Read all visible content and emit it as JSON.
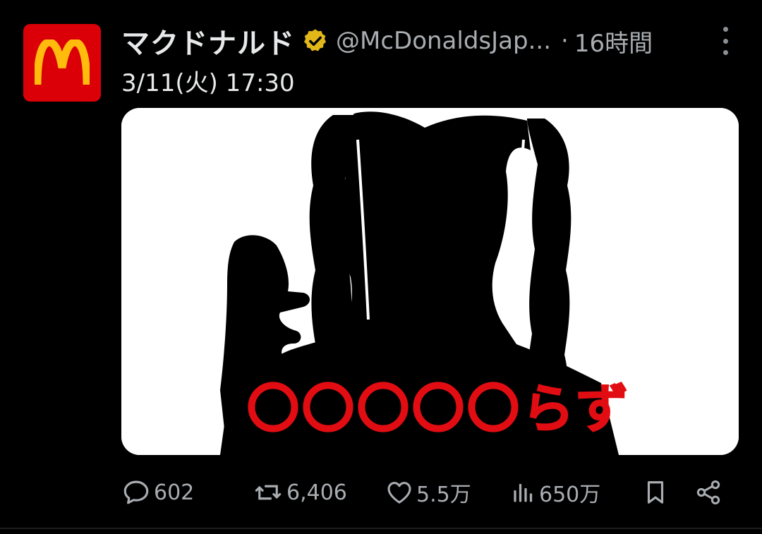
{
  "post": {
    "author_name": "マクドナルド",
    "handle": "@McDonaldsJap...",
    "separator": "·",
    "time": "16時間",
    "text": "3/11(火) 17:30",
    "media_overlay_text": "〇〇〇〇〇らず",
    "verified_color": "#e2b719",
    "avatar_color": "#db0007",
    "avatar_arches_color": "#ffbc0d",
    "overlay_color": "#e10d12"
  },
  "actions": {
    "reply": {
      "icon": "reply-icon",
      "count": "602"
    },
    "repost": {
      "icon": "repost-icon",
      "count": "6,406"
    },
    "like": {
      "icon": "heart-icon",
      "count": "5.5万"
    },
    "views": {
      "icon": "views-icon",
      "count": "650万"
    },
    "bookmark": {
      "icon": "bookmark-icon"
    },
    "share": {
      "icon": "share-icon"
    }
  }
}
